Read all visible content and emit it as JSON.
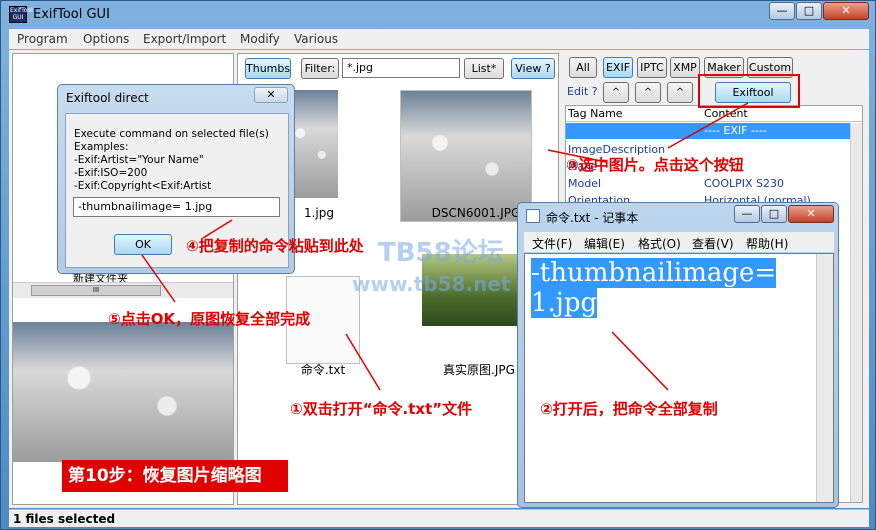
{
  "window": {
    "title": "ExifTool GUI",
    "icon_text": "ExifTool GUI"
  },
  "window_controls": {
    "minimize": "—",
    "maximize": "□",
    "close": "✕"
  },
  "menu": [
    "Program",
    "Options",
    "Export/Import",
    "Modify",
    "Various"
  ],
  "middle_toolbar": {
    "thumbs": "Thumbs",
    "filter_label": "Filter:",
    "filter_value": "*.jpg",
    "list": "List*",
    "view": "View ?"
  },
  "thumbnails": [
    {
      "label": "1.jpg"
    },
    {
      "label": "DSCN6001.JPG"
    },
    {
      "label": "命令.txt"
    },
    {
      "label": "真实原图.JPG"
    }
  ],
  "left_panel": {
    "folder_label": "新建文件夹",
    "scroll_glyph": "III"
  },
  "right_toolbar": {
    "all": "All",
    "exif": "EXIF",
    "iptc": "IPTC",
    "xmp": "XMP",
    "maker": "Maker",
    "custom": "Custom",
    "edit": "Edit ?",
    "exiftool_direct": "Exiftool direct"
  },
  "tag_table": {
    "headers": [
      "Tag Name",
      "Content"
    ],
    "rows": [
      {
        "name": "",
        "value": "---- EXIF ----",
        "selected": true
      },
      {
        "name": "ImageDescription",
        "value": ""
      },
      {
        "name": "Make",
        "value": ""
      },
      {
        "name": "Model",
        "value": "COOLPIX S230"
      },
      {
        "name": "Orientation",
        "value": "Horizontal (normal)"
      }
    ]
  },
  "status": "1 files selected",
  "dialog": {
    "title": "Exiftool direct",
    "close": "✕",
    "lines": [
      "Execute command on selected file(s)",
      "Examples:",
      "-Exif:Artist=\"Your Name\"",
      "-Exif:ISO=200",
      "-Exif:Copyright<Exif:Artist"
    ],
    "input_value": "-thumbnailimage= 1.jpg",
    "ok": "OK"
  },
  "notepad": {
    "title": "命令.txt - 记事本",
    "menu": [
      "文件(F)",
      "编辑(E)",
      "格式(O)",
      "查看(V)",
      "帮助(H)"
    ],
    "content_line1": "-thumbnailimage=",
    "content_line2": "1.jpg"
  },
  "annotations": {
    "a1": "①双击打开“命令.txt”文件",
    "a2": "②打开后，把命令全部复制",
    "a3": "③选中图片。点击这个按钮",
    "a4": "④把复制的命令粘贴到此处",
    "a5": "⑤点击OK，原图恢复全部完成",
    "step": "第10步：恢复图片缩略图"
  },
  "watermark": {
    "line1": "TB58论坛",
    "line2": "www.tb58.net"
  },
  "colors": {
    "annotation_red": "#e00000",
    "selection_blue": "#3399ff",
    "title_gradient": "#7fb2de"
  }
}
